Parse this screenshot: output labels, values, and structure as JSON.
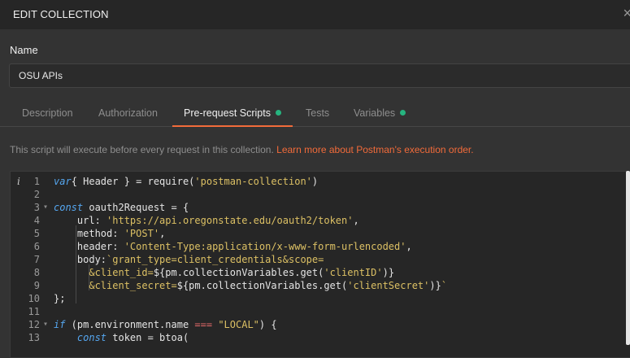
{
  "dialog": {
    "title": "EDIT COLLECTION",
    "close_glyph": "×"
  },
  "name_field": {
    "label": "Name",
    "value": "OSU APIs"
  },
  "tabs": [
    {
      "label": "Description",
      "active": false,
      "has_dot": false
    },
    {
      "label": "Authorization",
      "active": false,
      "has_dot": false
    },
    {
      "label": "Pre-request Scripts",
      "active": true,
      "has_dot": true
    },
    {
      "label": "Tests",
      "active": false,
      "has_dot": false
    },
    {
      "label": "Variables",
      "active": false,
      "has_dot": true
    }
  ],
  "info": {
    "text": "This script will execute before every request in this collection. ",
    "link": "Learn more about Postman's execution order."
  },
  "editor": {
    "info_icon_glyph": "i",
    "lines": [
      {
        "n": "1",
        "fold": "",
        "segs": [
          [
            "kw",
            "var"
          ],
          [
            "",
            "{ Header } = require("
          ],
          [
            "str",
            "'postman-collection'"
          ],
          [
            "",
            ")"
          ]
        ]
      },
      {
        "n": "2",
        "fold": "",
        "segs": []
      },
      {
        "n": "3",
        "fold": "▾",
        "segs": [
          [
            "kw",
            "const"
          ],
          [
            "",
            " oauth2Request = {"
          ]
        ]
      },
      {
        "n": "4",
        "fold": "",
        "segs": [
          [
            "",
            "    url: "
          ],
          [
            "str",
            "'https://api.oregonstate.edu/oauth2/token'"
          ],
          [
            "",
            ","
          ]
        ]
      },
      {
        "n": "5",
        "fold": "",
        "segs": [
          [
            "",
            "    method: "
          ],
          [
            "str",
            "'POST'"
          ],
          [
            "",
            ","
          ]
        ]
      },
      {
        "n": "6",
        "fold": "",
        "segs": [
          [
            "",
            "    header: "
          ],
          [
            "str",
            "'Content-Type:application/x-www-form-urlencoded'"
          ],
          [
            "",
            ","
          ]
        ]
      },
      {
        "n": "7",
        "fold": "",
        "segs": [
          [
            "",
            "    body:"
          ],
          [
            "str",
            "`grant_type=client_credentials&scope="
          ]
        ]
      },
      {
        "n": "8",
        "fold": "",
        "segs": [
          [
            "str",
            "      &client_id="
          ],
          [
            "",
            "${pm.collectionVariables.get("
          ],
          [
            "str",
            "'clientID'"
          ],
          [
            "",
            ")}"
          ]
        ]
      },
      {
        "n": "9",
        "fold": "",
        "segs": [
          [
            "str",
            "      &client_secret="
          ],
          [
            "",
            "${pm.collectionVariables.get("
          ],
          [
            "str",
            "'clientSecret'"
          ],
          [
            "",
            ")}"
          ],
          [
            "str",
            "`"
          ]
        ]
      },
      {
        "n": "10",
        "fold": "",
        "segs": [
          [
            "",
            "};"
          ]
        ]
      },
      {
        "n": "11",
        "fold": "",
        "segs": []
      },
      {
        "n": "12",
        "fold": "▾",
        "segs": [
          [
            "kw",
            "if"
          ],
          [
            "",
            " (pm.environment.name "
          ],
          [
            "op",
            "==="
          ],
          [
            "",
            " "
          ],
          [
            "str",
            "\"LOCAL\""
          ],
          [
            "",
            ") {"
          ]
        ]
      },
      {
        "n": "13",
        "fold": "",
        "segs": [
          [
            "",
            "    "
          ],
          [
            "kw",
            "const"
          ],
          [
            "",
            " token = btoa("
          ]
        ]
      }
    ]
  },
  "colors": {
    "accent": "#f26b3a",
    "dot_green": "#26b47f",
    "keyword": "#55a6ef",
    "string": "#dcc064",
    "operator": "#e66b6b"
  }
}
